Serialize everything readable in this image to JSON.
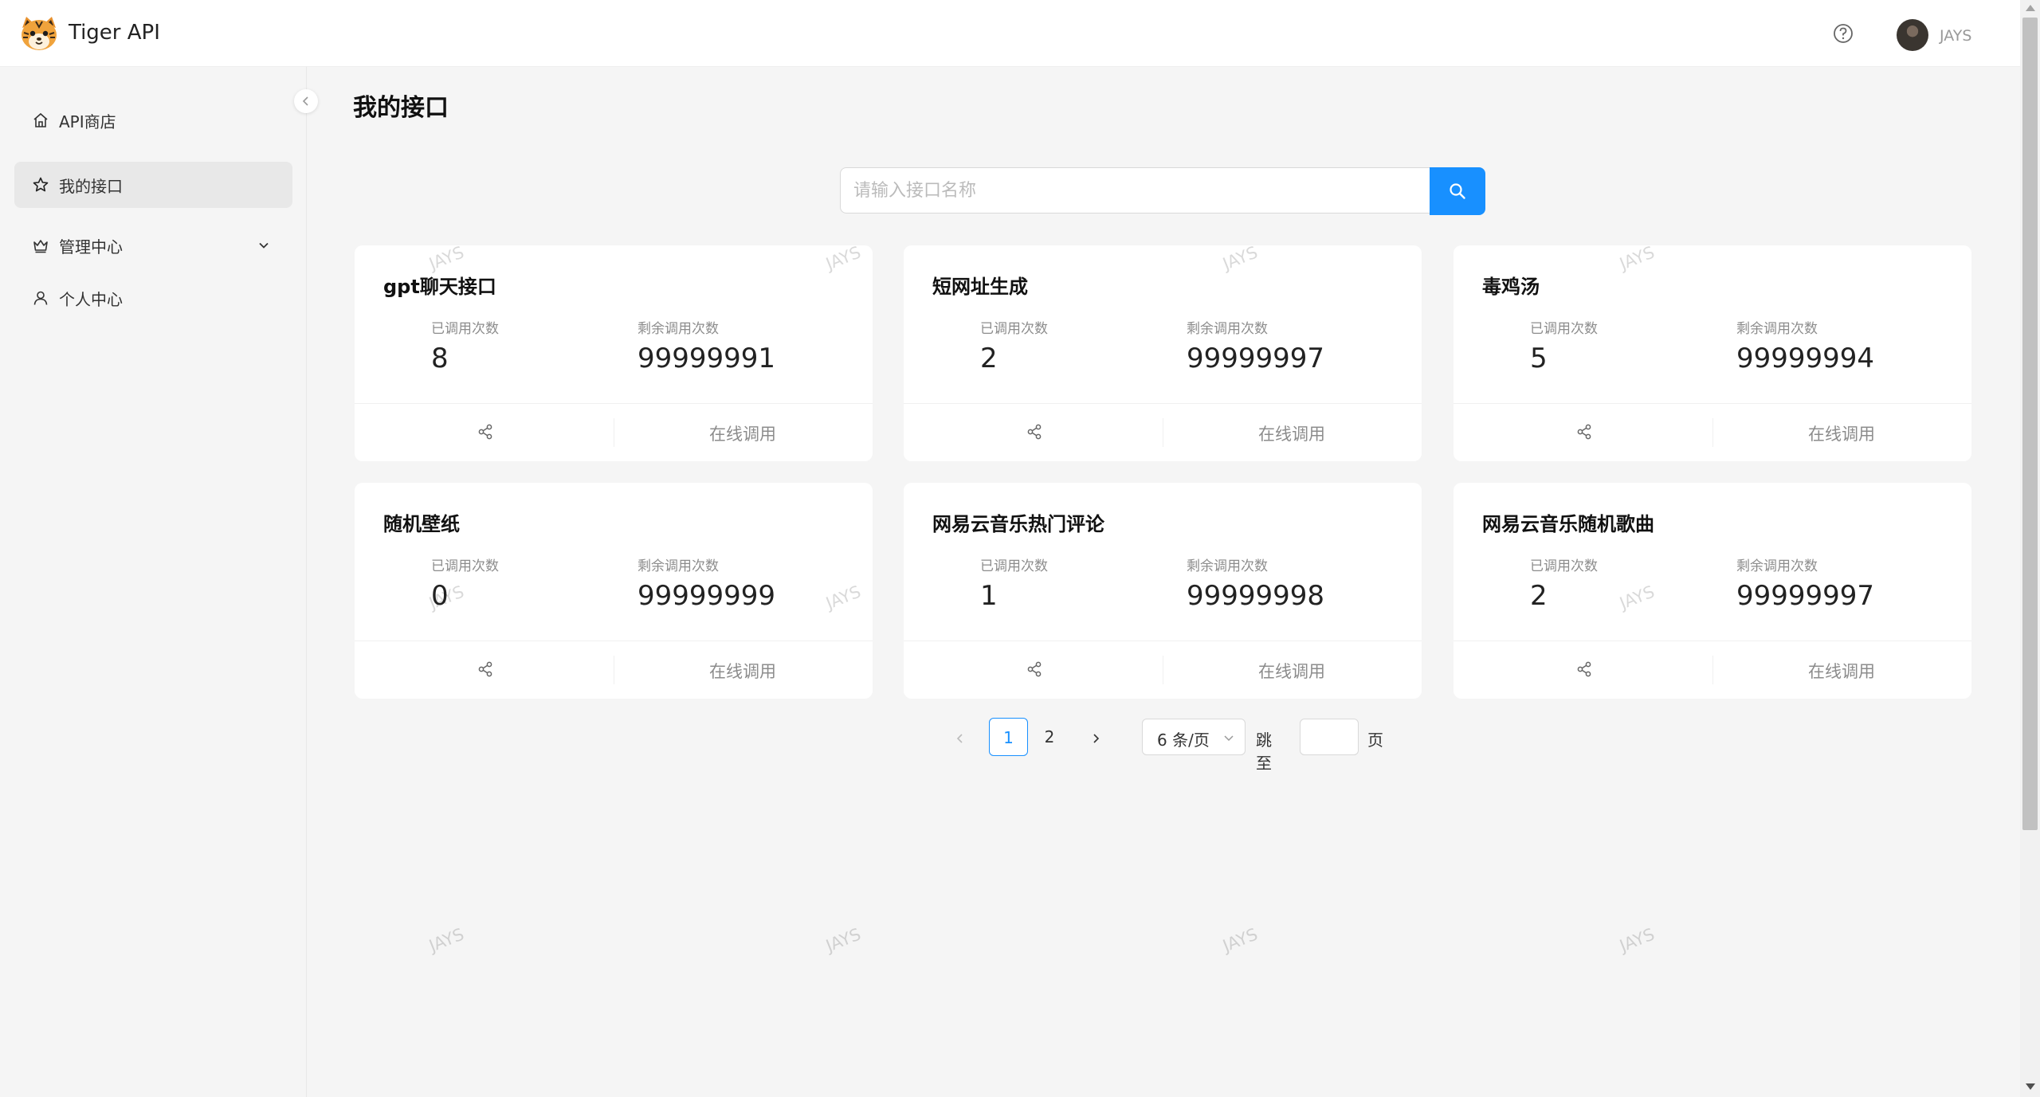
{
  "header": {
    "app_title": "Tiger API",
    "username": "JAYS"
  },
  "sidebar": {
    "items": [
      {
        "label": "API商店",
        "icon": "home-icon"
      },
      {
        "label": "我的接口",
        "icon": "star-icon",
        "active": true
      },
      {
        "label": "管理中心",
        "icon": "crown-icon",
        "expandable": true
      },
      {
        "label": "个人中心",
        "icon": "user-icon"
      }
    ]
  },
  "main": {
    "page_title": "我的接口",
    "search": {
      "placeholder": "请输入接口名称",
      "value": ""
    },
    "stat_labels": {
      "used": "已调用次数",
      "remaining": "剩余调用次数"
    },
    "action_label": "在线调用",
    "cards": [
      {
        "name": "gpt聊天接口",
        "used": "8",
        "remaining": "99999991"
      },
      {
        "name": "短网址生成",
        "used": "2",
        "remaining": "99999997"
      },
      {
        "name": "毒鸡汤",
        "used": "5",
        "remaining": "99999994"
      },
      {
        "name": "随机壁纸",
        "used": "0",
        "remaining": "99999999"
      },
      {
        "name": "网易云音乐热门评论",
        "used": "1",
        "remaining": "99999998"
      },
      {
        "name": "网易云音乐随机歌曲",
        "used": "2",
        "remaining": "99999997"
      }
    ]
  },
  "pagination": {
    "pages": [
      "1",
      "2"
    ],
    "current": "1",
    "page_size": "6 条/页",
    "jump_label": "跳至",
    "page_suffix": "页"
  },
  "watermark": "JAYS",
  "colors": {
    "primary": "#1890ff",
    "background": "#f5f5f5"
  }
}
